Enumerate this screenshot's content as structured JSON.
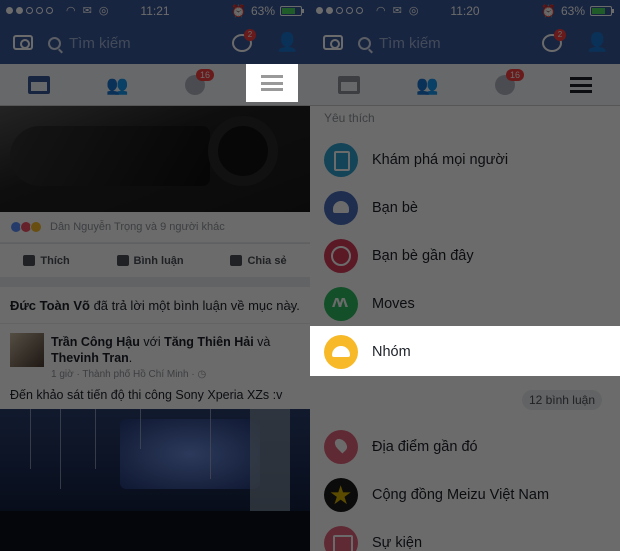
{
  "left": {
    "status": {
      "time": "11:21",
      "battery": "63%"
    },
    "header": {
      "search_placeholder": "Tìm kiếm",
      "messenger_badge": "2"
    },
    "tabs": {
      "notifications_badge": "16"
    },
    "post1": {
      "reaction_text": "Dân Nguyễn Trọng và 9 người khác",
      "like_label": "Thích",
      "comment_label": "Bình luận",
      "share_label": "Chia sẻ"
    },
    "comment_notice": {
      "author": "Đức Toàn Võ",
      "text": " đã trả lời một bình luận về mục này."
    },
    "post2": {
      "author": "Trần Công Hậu",
      "with_word": " với ",
      "tagged1": "Tăng Thiên Hải",
      "and_word": " và ",
      "tagged2": "Thevinh Tran",
      "dot": ".",
      "meta": "1 giờ · Thành phố Hồ Chí Minh · ◷",
      "text": "Đến khảo sát tiến độ thi công Sony Xperia XZs :v"
    }
  },
  "right": {
    "status": {
      "time": "11:20",
      "battery": "63%"
    },
    "header": {
      "search_placeholder": "Tìm kiếm",
      "messenger_badge": "2"
    },
    "tabs": {
      "notifications_badge": "16"
    },
    "favorites_heading": "Yêu thích",
    "menu": [
      {
        "label": "Khám phá mọi người",
        "icon": "explore-people-icon"
      },
      {
        "label": "Bạn bè",
        "icon": "friends-icon"
      },
      {
        "label": "Bạn bè gần đây",
        "icon": "nearby-friends-icon"
      },
      {
        "label": "Moves",
        "icon": "moves-icon"
      },
      {
        "label": "Nhóm",
        "icon": "groups-icon"
      },
      {
        "label": "Địa điểm gần đó",
        "icon": "places-icon"
      },
      {
        "label": "Cộng đồng Meizu Việt Nam",
        "icon": "meizu-community-icon"
      },
      {
        "label": "Sự kiện",
        "icon": "events-icon"
      }
    ],
    "comments_pill": "12 bình luận"
  },
  "colors": {
    "facebook_blue": "#3b5998",
    "badge_red": "#fa3e3e",
    "groups_yellow": "#f7b928"
  }
}
